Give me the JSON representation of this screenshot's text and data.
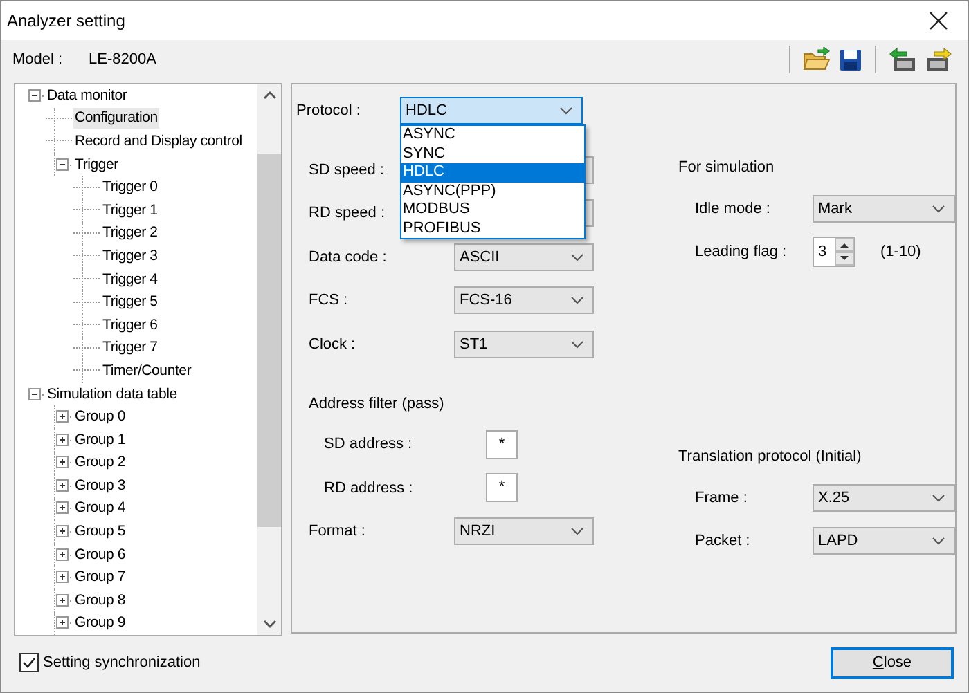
{
  "window": {
    "title": "Analyzer setting"
  },
  "model": {
    "label": "Model :",
    "value": "LE-8200A"
  },
  "tree": [
    {
      "label": "Data monitor",
      "expanded": true,
      "selected": false,
      "children": [
        {
          "label": "Configuration",
          "selected": true
        },
        {
          "label": "Record and Display control",
          "selected": false
        },
        {
          "label": "Trigger",
          "expanded": true,
          "selected": false,
          "children": [
            {
              "label": "Trigger 0",
              "selected": false
            },
            {
              "label": "Trigger 1",
              "selected": false
            },
            {
              "label": "Trigger 2",
              "selected": false
            },
            {
              "label": "Trigger 3",
              "selected": false
            },
            {
              "label": "Trigger 4",
              "selected": false
            },
            {
              "label": "Trigger 5",
              "selected": false
            },
            {
              "label": "Trigger 6",
              "selected": false
            },
            {
              "label": "Trigger 7",
              "selected": false
            },
            {
              "label": "Timer/Counter",
              "selected": false
            }
          ]
        }
      ]
    },
    {
      "label": "Simulation data table",
      "expanded": true,
      "selected": false,
      "children": [
        {
          "label": "Group 0",
          "expanded": false,
          "selected": false
        },
        {
          "label": "Group 1",
          "expanded": false,
          "selected": false
        },
        {
          "label": "Group 2",
          "expanded": false,
          "selected": false
        },
        {
          "label": "Group 3",
          "expanded": false,
          "selected": false
        },
        {
          "label": "Group 4",
          "expanded": false,
          "selected": false
        },
        {
          "label": "Group 5",
          "expanded": false,
          "selected": false
        },
        {
          "label": "Group 6",
          "expanded": false,
          "selected": false
        },
        {
          "label": "Group 7",
          "expanded": false,
          "selected": false
        },
        {
          "label": "Group 8",
          "expanded": false,
          "selected": false
        },
        {
          "label": "Group 9",
          "expanded": false,
          "selected": false
        }
      ]
    }
  ],
  "protocol": {
    "label": "Protocol :",
    "value": "HDLC",
    "options": [
      {
        "label": "ASYNC",
        "selected": false
      },
      {
        "label": "SYNC",
        "selected": false
      },
      {
        "label": "HDLC",
        "selected": true
      },
      {
        "label": "ASYNC(PPP)",
        "selected": false
      },
      {
        "label": "MODBUS",
        "selected": false
      },
      {
        "label": "PROFIBUS",
        "selected": false
      }
    ]
  },
  "left_fields": [
    {
      "kind": "combo",
      "label": "SD speed :"
    },
    {
      "kind": "combo",
      "label": "RD speed :"
    },
    {
      "kind": "combo",
      "label": "Data code :",
      "value": "ASCII"
    },
    {
      "kind": "combo",
      "label": "FCS :",
      "value": "FCS-16"
    },
    {
      "kind": "combo",
      "label": "Clock :",
      "value": "ST1"
    },
    {
      "kind": "heading",
      "label": "Address filter (pass)"
    },
    {
      "kind": "text",
      "label": "SD address :",
      "value": "*"
    },
    {
      "kind": "text",
      "label": "RD address :",
      "value": "*"
    },
    {
      "kind": "combo",
      "label": "Format :",
      "value": "NRZI"
    }
  ],
  "right_fields": [
    {
      "kind": "heading",
      "label": "For simulation"
    },
    {
      "kind": "combo",
      "label": "Idle mode :",
      "value": "Mark"
    },
    {
      "kind": "spin",
      "label": "Leading flag :",
      "value": "3",
      "hint": "(1-10)"
    },
    {
      "kind": "heading",
      "label": "Translation protocol (Initial)"
    },
    {
      "kind": "combo",
      "label": "Frame :",
      "value": "X.25"
    },
    {
      "kind": "combo",
      "label": "Packet :",
      "value": "LAPD"
    }
  ],
  "sync_checkbox": {
    "label": "Setting synchronization",
    "checked": true
  },
  "close_button": "Close"
}
